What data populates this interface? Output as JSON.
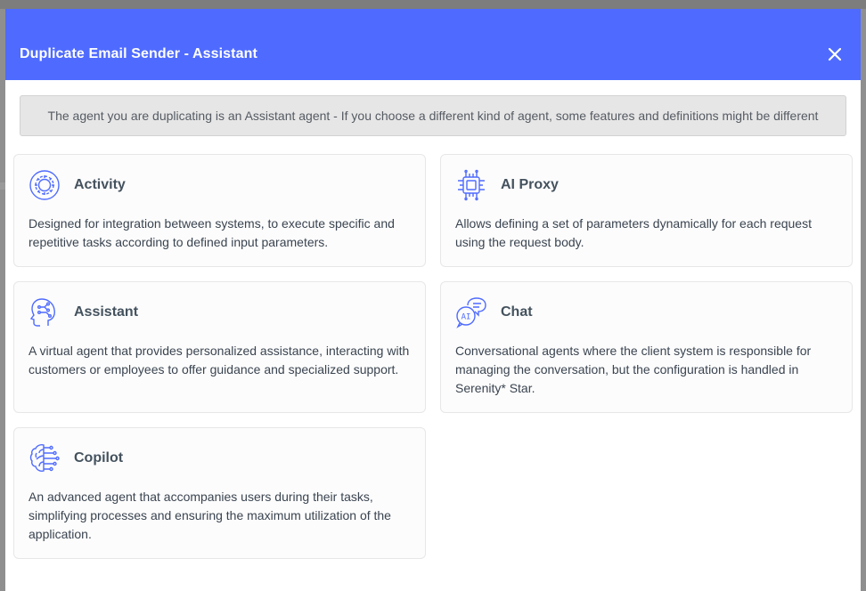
{
  "modal": {
    "title": "Duplicate Email Sender - Assistant",
    "close_icon": "close-icon",
    "notice": "The agent you are duplicating is an Assistant agent - If you choose a different kind of agent, some features and definitions might be different"
  },
  "colors": {
    "header": "#4f6bff",
    "icon": "#4f6bff",
    "notice_bg": "#e6e6e6"
  },
  "agents": [
    {
      "title": "Activity",
      "icon": "gear-cycle-icon",
      "description": "Designed for integration between systems, to execute specific and repetitive tasks according to defined input parameters."
    },
    {
      "title": "AI Proxy",
      "icon": "cpu-chip-icon",
      "description": "Allows defining a set of parameters dynamically for each request using the request body."
    },
    {
      "title": "Assistant",
      "icon": "brain-head-icon",
      "description": "A virtual agent that provides personalized assistance, interacting with customers or employees to offer guidance and specialized support."
    },
    {
      "title": "Chat",
      "icon": "ai-chat-bubble-icon",
      "description": "Conversational agents where the client system is responsible for managing the conversation, but the configuration is handled in Serenity* Star."
    },
    {
      "title": "Copilot",
      "icon": "brain-circuit-icon",
      "description": "An advanced agent that accompanies users during their tasks, simplifying processes and ensuring the maximum utilization of the application."
    }
  ]
}
